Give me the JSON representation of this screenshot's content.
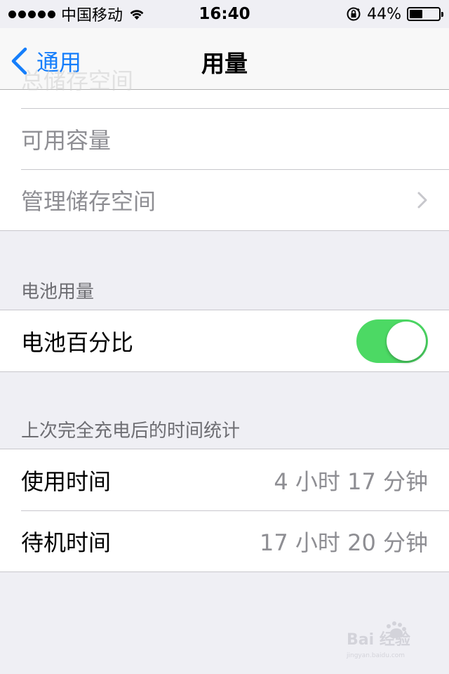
{
  "status_bar": {
    "carrier": "中国移动",
    "time": "16:40",
    "battery_percent": "44%",
    "battery_level": 0.44
  },
  "nav": {
    "back_label": "通用",
    "title": "用量"
  },
  "storage": {
    "ghost_label": "总储存空间",
    "available_label": "可用容量",
    "manage_label": "管理储存空间"
  },
  "battery_section": {
    "header": "电池用量",
    "percentage_label": "电池百分比",
    "percentage_enabled": true
  },
  "usage_section": {
    "header": "上次完全充电后的时间统计",
    "rows": [
      {
        "label": "使用时间",
        "value": "4 小时 17 分钟"
      },
      {
        "label": "待机时间",
        "value": "17 小时 20 分钟"
      }
    ]
  },
  "colors": {
    "accent": "#157efb",
    "toggle_on": "#4cd964",
    "background": "#efeff4"
  },
  "watermark": {
    "text": "Bai 经验",
    "sub": "jingyan.baidu.com"
  }
}
